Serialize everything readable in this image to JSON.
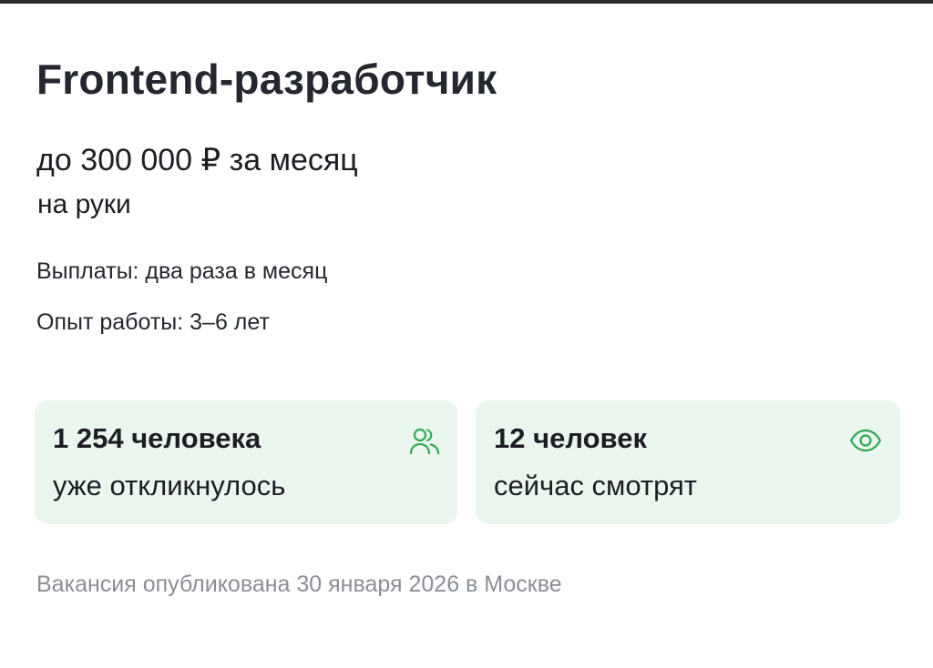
{
  "vacancy": {
    "title": "Frontend-разработчик",
    "salary": "до 300 000 ₽ за месяц",
    "salary_note": "на руки",
    "payments": "Выплаты: два раза в месяц",
    "experience": "Опыт работы: 3–6 лет"
  },
  "stats": {
    "applied": {
      "count": "1 254 человека",
      "label": "уже откликнулось",
      "icon": "people-icon"
    },
    "viewing": {
      "count": "12 человек",
      "label": "сейчас смотрят",
      "icon": "eye-icon"
    }
  },
  "footer": {
    "published": "Вакансия опубликована 30 января 2026 в Москве"
  },
  "colors": {
    "card_background": "#ebf7ee",
    "icon_green": "#2fa84f",
    "muted_text": "#8a8e96"
  }
}
